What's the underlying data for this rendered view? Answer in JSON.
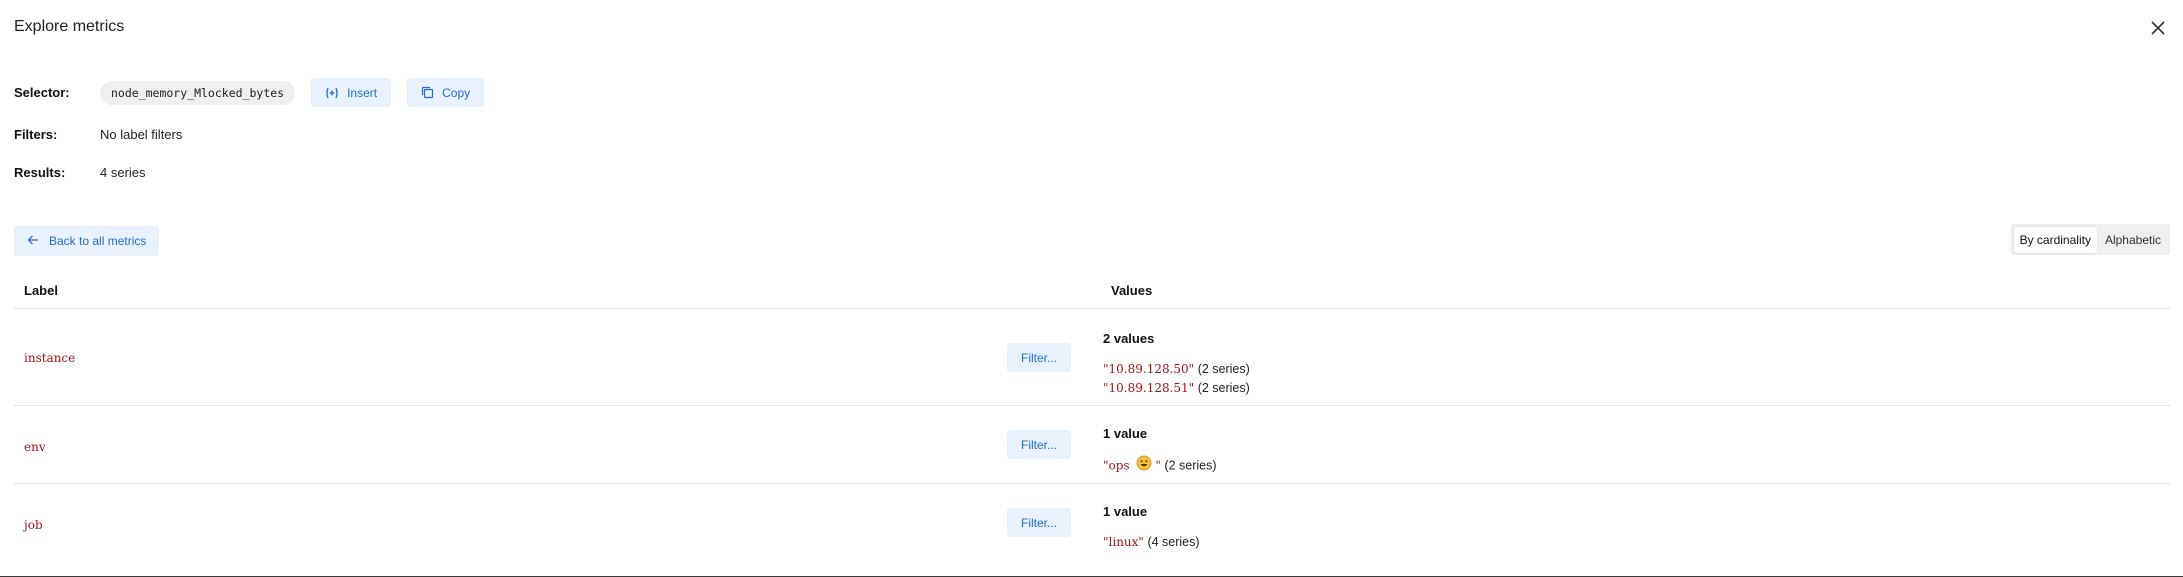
{
  "dialog": {
    "title": "Explore metrics"
  },
  "summary": {
    "selector_label": "Selector:",
    "selector_value": "node_memory_Mlocked_bytes",
    "insert_label": "Insert",
    "copy_label": "Copy",
    "filters_label": "Filters:",
    "filters_value": "No label filters",
    "results_label": "Results:",
    "results_value": "4 series"
  },
  "toolbar": {
    "back_label": "Back to all metrics",
    "sort_options": [
      "By cardinality",
      "Alphabetic"
    ],
    "sort_selected": "By cardinality"
  },
  "table": {
    "headers": {
      "label": "Label",
      "values": "Values"
    },
    "filter_label": "Filter...",
    "rows": [
      {
        "label": "instance",
        "count": "2 values",
        "values": [
          {
            "value": "\"10.89.128.50\"",
            "series": "(2 series)"
          },
          {
            "value": "\"10.89.128.51\"",
            "series": "(2 series)"
          }
        ]
      },
      {
        "label": "env",
        "count": "1 value",
        "values": [
          {
            "value_prefix": "\"ops ",
            "emoji": "grinning-face-icon",
            "value_suffix": "\"",
            "series": "(2 series)"
          }
        ]
      },
      {
        "label": "job",
        "count": "1 value",
        "values": [
          {
            "value": "\"linux\"",
            "series": "(4 series)"
          }
        ]
      }
    ]
  },
  "colors": {
    "accent": "#1f6fd1",
    "accent_bg": "#e8f1fc",
    "label_red": "#a31515"
  }
}
